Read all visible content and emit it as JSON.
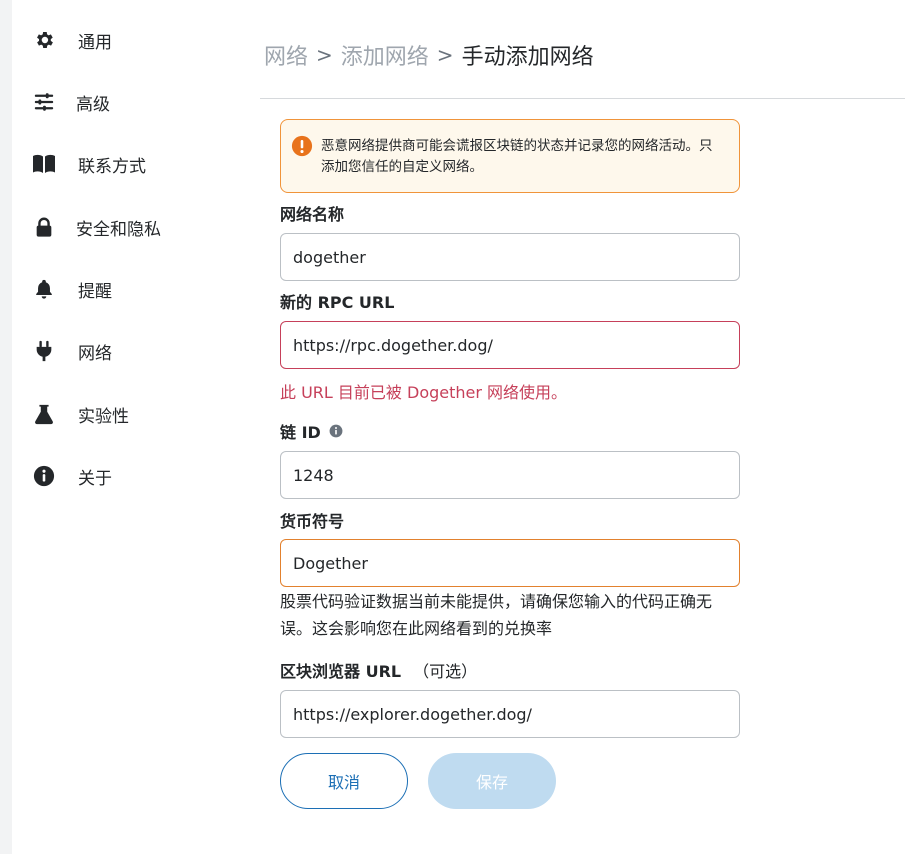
{
  "sidebar": {
    "items": [
      {
        "label": "通用",
        "icon": "gear-icon"
      },
      {
        "label": "高级",
        "icon": "sliders-icon"
      },
      {
        "label": "联系方式",
        "icon": "book-icon"
      },
      {
        "label": "安全和隐私",
        "icon": "lock-icon"
      },
      {
        "label": "提醒",
        "icon": "bell-icon"
      },
      {
        "label": "网络",
        "icon": "plug-icon"
      },
      {
        "label": "实验性",
        "icon": "flask-icon"
      },
      {
        "label": "关于",
        "icon": "info-icon"
      }
    ]
  },
  "breadcrumb": {
    "level1": "网络",
    "level2": "添加网络",
    "current": "手动添加网络",
    "separator": ">"
  },
  "warning": {
    "text": "恶意网络提供商可能会谎报区块链的状态并记录您的网络活动。只添加您信任的自定义网络。",
    "icon": "exclamation-icon",
    "color": "#f0943a"
  },
  "form": {
    "network_name": {
      "label": "网络名称",
      "value": "dogether"
    },
    "rpc_url": {
      "label": "新的 RPC URL",
      "value": "https://rpc.dogether.dog/",
      "error": "此 URL 目前已被 Dogether 网络使用。"
    },
    "chain_id": {
      "label": "链 ID",
      "value": "1248",
      "info_icon": "info-circle-icon"
    },
    "currency_symbol": {
      "label": "货币符号",
      "value": "Dogether",
      "warning": "股票代码验证数据当前未能提供，请确保您输入的代码正确无误。这会影响您在此网络看到的兑换率"
    },
    "explorer_url": {
      "label": "区块浏览器 URL",
      "optional": "（可选）",
      "value": "https://explorer.dogether.dog/"
    }
  },
  "buttons": {
    "cancel": "取消",
    "save": "保存"
  },
  "colors": {
    "primary": "#1c6fb5",
    "error": "#c6405a",
    "warning_border": "#e2812e",
    "disabled_button": "#bfdbf0"
  }
}
